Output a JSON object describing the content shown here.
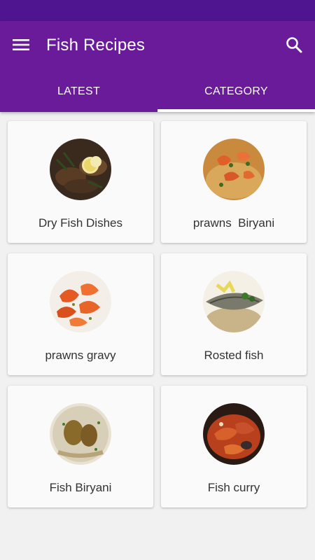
{
  "app": {
    "title": "Fish Recipes"
  },
  "toolbar": {
    "menu_icon": "menu-icon",
    "search_icon": "search-icon"
  },
  "tabs": [
    {
      "label": "LATEST",
      "active": false
    },
    {
      "label": "CATEGORY",
      "active": true
    }
  ],
  "categories": [
    {
      "label": "Dry Fish Dishes",
      "image": "dry-fish-dishes-image"
    },
    {
      "label": "prawns  Biryani",
      "image": "prawns-biryani-image"
    },
    {
      "label": "prawns gravy",
      "image": "prawns-gravy-image"
    },
    {
      "label": "Rosted fish",
      "image": "roasted-fish-image"
    },
    {
      "label": "Fish Biryani",
      "image": "fish-biryani-image"
    },
    {
      "label": "Fish curry",
      "image": "fish-curry-image"
    }
  ],
  "colors": {
    "status_bar": "#4f1590",
    "app_bar": "#6a1b9a",
    "background": "#f1f1f1",
    "card": "#fafafa"
  }
}
